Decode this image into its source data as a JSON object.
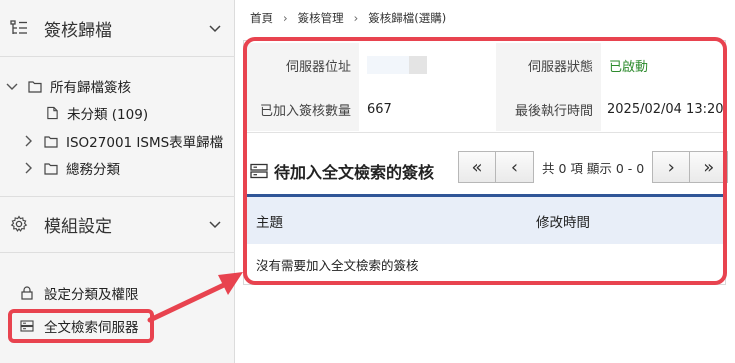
{
  "sidebar": {
    "section1_title": "簽核歸檔",
    "tree": [
      {
        "label": "所有歸檔簽核",
        "toggle": "open",
        "icon": "folder-icon"
      },
      {
        "label": "未分類 (109)",
        "toggle": "none",
        "icon": "file-icon"
      },
      {
        "label": "ISO27001 ISMS表單歸檔",
        "toggle": "closed",
        "icon": "folder-icon"
      },
      {
        "label": "總務分類",
        "toggle": "closed",
        "icon": "folder-icon"
      }
    ],
    "section2_title": "模組設定",
    "menu": [
      {
        "label": "設定分類及權限",
        "icon": "lock-icon"
      },
      {
        "label": "全文檢索伺服器",
        "icon": "server-icon"
      }
    ]
  },
  "breadcrumb": [
    "首頁",
    "簽核管理",
    "簽核歸檔(選購)"
  ],
  "server_info": {
    "address_label": "伺服器位址",
    "address_value": "",
    "status_label": "伺服器狀態",
    "status_value": "已啟動",
    "count_label": "已加入簽核數量",
    "count_value": "667",
    "last_exec_label": "最後執行時間",
    "last_exec_value": "2025/02/04 13:20"
  },
  "pending": {
    "title": "待加入全文檢索的簽核",
    "pager_text": "共 0 項 顯示 0 - 0",
    "columns": [
      "主題",
      "修改時間"
    ],
    "empty_text": "沒有需要加入全文檢索的簽核"
  },
  "colors": {
    "highlight": "#e8434f",
    "status_ok": "#2e8b2e",
    "table_accent": "#2f5597"
  }
}
